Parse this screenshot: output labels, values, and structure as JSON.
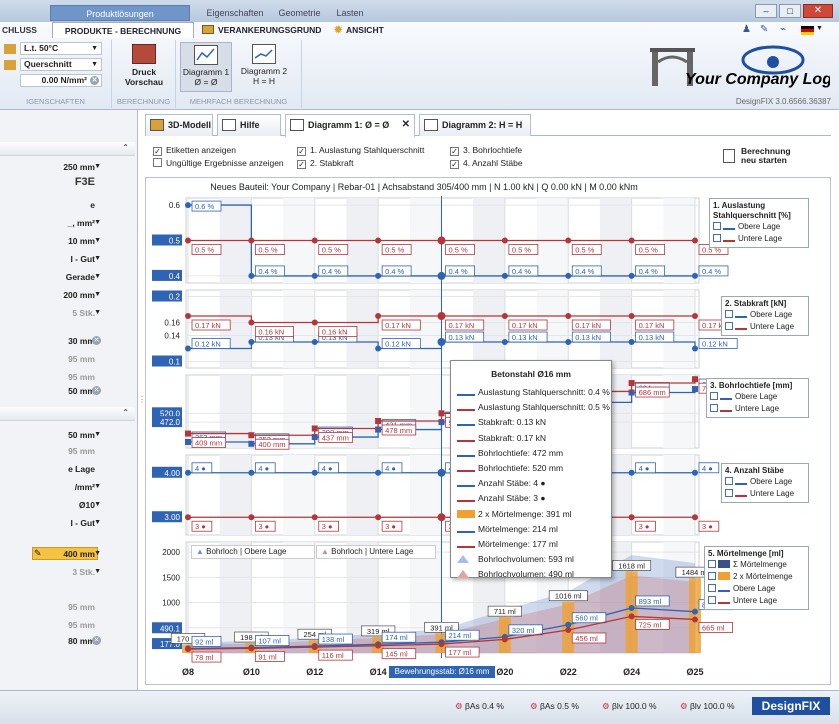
{
  "window": {
    "tabs": [
      "Produktlösungen",
      "Eigenschaften",
      "Geometrie",
      "Lasten"
    ]
  },
  "ribbon": {
    "tabs": [
      "CHLUSS",
      "PRODUKTE - BERECHNUNG",
      "VERANKERUNGSGRUND",
      "ANSICHT"
    ],
    "inputs": {
      "temp": "L.t. 50°C",
      "section": "Querschnitt",
      "load": "0.00 N/mm²"
    },
    "groups": [
      "IGENSCHAFTEN",
      "BERECHNUNG",
      "MEHRFACH BERECHNUNG"
    ],
    "buttons": {
      "print": "Druck",
      "preview": "Vorschau",
      "d1a": "Diagramm 1",
      "d1b": "Ø = Ø",
      "d2a": "Diagramm 2",
      "d2b": "H = H"
    },
    "logo": "Your Company Logo",
    "version": "DesignFIX 3.0.6566.36387"
  },
  "sidebar": {
    "items": [
      "250 mm",
      "F3E",
      "e",
      "_, mm²",
      "10 mm",
      "I - Gut",
      "Gerade",
      "200 mm",
      "5 Stk.",
      "30 mm",
      "95 mm",
      "95 mm",
      "50 mm",
      "50 mm",
      "95 mm",
      "e Lage",
      "/mm²",
      "Ø10",
      "I - Gut",
      "400 mm",
      "3 Stk.",
      "95 mm",
      "95 mm",
      "80 mm"
    ]
  },
  "doctabs": {
    "tabs": [
      "3D-Modell",
      "Hilfe",
      "Diagramm 1: Ø = Ø",
      "Diagramm 2: H = H"
    ]
  },
  "options": {
    "etiketten": "Etiketten anzeigen",
    "ungueltig": "Ungültige Ergebnisse anzeigen",
    "c1": "1. Auslastung Stahlquerschnitt",
    "c2": "2. Stabkraft",
    "c3": "3. Bohrlochtiefe",
    "c4": "4. Anzahl Stäbe",
    "recalc1": "Berechnung",
    "recalc2": "neu starten"
  },
  "chart_data": {
    "type": "line",
    "title": "Neues Bauteil: Your Company | Rebar-01 | Achsabstand 305/400 mm | N 1.00 kN | Q 0.00 kN | M 0.00 kNm",
    "categories": [
      "Ø8",
      "Ø10",
      "Ø12",
      "Ø14",
      "Ø16",
      "Ø20",
      "Ø22",
      "Ø24",
      "Ø25"
    ],
    "xcursor": "Bewehrungsstab: Ø16 mm",
    "panels": [
      {
        "name": "1. Auslastung Stahlquerschnitt [%]",
        "ylim": [
          0.4,
          0.6
        ],
        "ticks": [
          "0.6",
          "0.5",
          "0.4"
        ],
        "series": [
          {
            "name": "Obere Lage",
            "labels": [
              "0.6 %",
              "0.4 %",
              "0.4 %",
              "0.4 %",
              "0.4 %",
              "0.4 %",
              "0.4 %",
              "0.4 %",
              "0.4 %"
            ],
            "values": [
              0.6,
              0.4,
              0.4,
              0.4,
              0.4,
              0.4,
              0.4,
              0.4,
              0.4
            ]
          },
          {
            "name": "Untere Lage",
            "labels": [
              "0.5 %",
              "0.5 %",
              "0.5 %",
              "0.5 %",
              "0.5 %",
              "0.5 %",
              "0.5 %",
              "0.5 %",
              "0.5 %"
            ],
            "values": [
              0.5,
              0.5,
              0.5,
              0.5,
              0.5,
              0.5,
              0.5,
              0.5,
              0.5
            ]
          }
        ]
      },
      {
        "name": "2. Stabkraft [kN]",
        "ylim": [
          0.1,
          0.2
        ],
        "ticks": [
          "0.2",
          "0.16",
          "0.14",
          "0.1"
        ],
        "series": [
          {
            "name": "Obere Lage",
            "labels": [
              "0.12 kN",
              "0.13 kN",
              "0.13 kN",
              "0.12 kN",
              "0.13 kN",
              "0.13 kN",
              "0.13 kN",
              "0.13 kN",
              "0.12 kN"
            ],
            "values": [
              0.12,
              0.13,
              0.13,
              0.12,
              0.13,
              0.13,
              0.13,
              0.13,
              0.12
            ]
          },
          {
            "name": "Untere Lage",
            "labels": [
              "0.17 kN",
              "0.16 kN",
              "0.16 kN",
              "0.17 kN",
              "0.17 kN",
              "0.17 kN",
              "0.17 kN",
              "0.17 kN",
              "0.17 kN"
            ],
            "values": [
              0.17,
              0.16,
              0.16,
              0.17,
              0.17,
              0.17,
              0.17,
              0.17,
              0.17
            ]
          }
        ]
      },
      {
        "name": "3. Bohrlochtiefe [mm]",
        "ylim": [
          340,
          720
        ],
        "ticks": [
          "520.0",
          "472.0"
        ],
        "series": [
          {
            "name": "Obere Lage",
            "labels": [
              "363 mm",
              "353 mm",
              "390 mm",
              "431 mm",
              "472 mm",
              "",
              "",
              "634 mm",
              "653 mm"
            ],
            "values": [
              363,
              353,
              390,
              431,
              472,
              540,
              580,
              634,
              653
            ]
          },
          {
            "name": "Untere Lage",
            "labels": [
              "409 mm",
              "400 mm",
              "437 mm",
              "478 mm",
              "520 mm",
              "",
              "",
              "686 mm",
              "707 mm"
            ],
            "values": [
              409,
              400,
              437,
              478,
              520,
              590,
              640,
              686,
              707
            ]
          }
        ]
      },
      {
        "name": "4. Anzahl Stäbe",
        "ticks": [
          "4.00",
          "3.00"
        ],
        "series": [
          {
            "name": "Obere Lage",
            "labels": [
              "4 ●",
              "4 ●",
              "4 ●",
              "4 ●",
              "4 ●",
              "4 ●",
              "4 ●",
              "4 ●",
              "4 ●"
            ],
            "values": [
              4,
              4,
              4,
              4,
              4,
              4,
              4,
              4,
              4
            ]
          },
          {
            "name": "Untere Lage",
            "labels": [
              "3 ●",
              "3 ●",
              "3 ●",
              "3 ●",
              "3 ●",
              "3 ●",
              "3 ●",
              "3 ●",
              "3 ●"
            ],
            "values": [
              3,
              3,
              3,
              3,
              3,
              3,
              3,
              3,
              3
            ]
          }
        ]
      },
      {
        "name": "5. Mörtelmenge [ml]",
        "ylim": [
          0,
          2000
        ],
        "ticks": [
          "2000",
          "1500",
          "1000",
          "500",
          "490.1",
          "177.0"
        ],
        "legend_items": [
          "Σ Mörtelmenge",
          "2 x Mörtelmenge",
          "Obere Lage",
          "Untere Lage"
        ],
        "series": [
          {
            "name": "Obere Lage",
            "labels": [
              "92 ml",
              "107 ml",
              "138 ml",
              "174 ml",
              "214 ml",
              "320 ml",
              "560 ml",
              "893 ml",
              "819 ml"
            ],
            "values": [
              92,
              107,
              138,
              174,
              214,
              320,
              560,
              893,
              819
            ]
          },
          {
            "name": "Untere Lage",
            "labels": [
              "78 ml",
              "91 ml",
              "116 ml",
              "145 ml",
              "177 ml",
              "",
              "456 ml",
              "725 ml",
              "665 ml"
            ],
            "values": [
              78,
              91,
              116,
              145,
              177,
              270,
              456,
              725,
              665
            ]
          },
          {
            "name": "Σ",
            "labels": [
              "170 ml",
              "198 ml",
              "254 ml",
              "319 ml",
              "391 ml",
              "711 ml",
              "1016 ml",
              "1618 ml",
              "1484 ml"
            ],
            "values": [
              170,
              198,
              254,
              319,
              391,
              711,
              1016,
              1618,
              1484
            ]
          }
        ],
        "area_legend": [
          "Bohrloch | Obere Lage",
          "Bohrloch | Untere Lage"
        ]
      }
    ]
  },
  "tooltip": {
    "title": "Betonstahl Ø16 mm",
    "rows": [
      "Auslastung Stahlquerschnitt: 0.4 %",
      "Auslastung Stahlquerschnitt: 0.5 %",
      "Stabkraft: 0.13 kN",
      "Stabkraft: 0.17 kN",
      "Bohrlochtiefe: 472 mm",
      "Bohrlochtiefe: 520 mm",
      "Anzahl Stäbe: 4 ●",
      "Anzahl Stäbe: 3 ●",
      "2 x Mörtelmenge: 391 ml",
      "Mörtelmenge: 214 ml",
      "Mörtelmenge: 177 ml",
      "Bohrlochvolumen: 593 ml",
      "Bohrlochvolumen: 490 ml"
    ]
  },
  "status": {
    "s1": "βAs 0.4 %",
    "s2": "βAs 0.5 %",
    "s3": "βlv 100.0 %",
    "s4": "βlv 100.0 %",
    "brand": "DesignFIX"
  },
  "colors": {
    "blue": "#2f63b4",
    "red": "#b3363a",
    "orange": "#f0a030"
  }
}
